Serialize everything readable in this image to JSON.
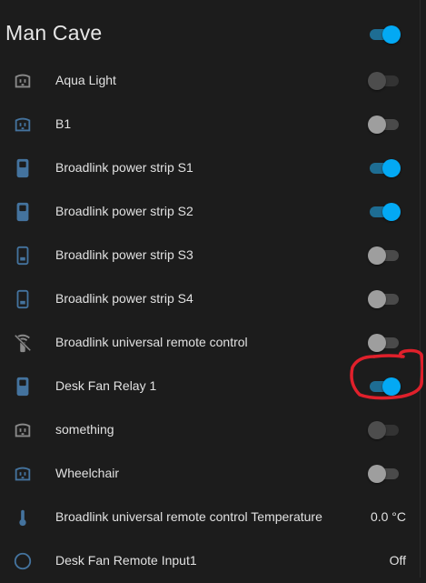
{
  "card": {
    "title": "Man Cave",
    "master_toggle": "on"
  },
  "colors": {
    "accent": "#03a9f4",
    "icon_blue": "#44739e",
    "icon_gray": "#8a8a8a",
    "annotation": "#e0202b"
  },
  "rows": [
    {
      "label": "Aqua Light",
      "icon": "outlet-icon",
      "state": "unavailable"
    },
    {
      "label": "B1",
      "icon": "outlet-icon",
      "state": "off"
    },
    {
      "label": "Broadlink power strip S1",
      "icon": "power-socket-icon",
      "state": "on"
    },
    {
      "label": "Broadlink power strip S2",
      "icon": "power-socket-icon",
      "state": "on"
    },
    {
      "label": "Broadlink power strip S3",
      "icon": "power-socket-outline-icon",
      "state": "off"
    },
    {
      "label": "Broadlink power strip S4",
      "icon": "power-socket-outline-icon",
      "state": "off"
    },
    {
      "label": "Broadlink universal remote control",
      "icon": "remote-off-icon",
      "state": "off"
    },
    {
      "label": "Desk Fan Relay 1",
      "icon": "power-socket-icon",
      "state": "on"
    },
    {
      "label": "something",
      "icon": "outlet-icon",
      "state": "unavailable"
    },
    {
      "label": "Wheelchair",
      "icon": "outlet-icon",
      "state": "off"
    },
    {
      "label": "Broadlink universal remote control Temperature",
      "icon": "thermometer-icon",
      "value": "0.0 °C"
    },
    {
      "label": "Desk Fan Remote Input1",
      "icon": "circle-outline-icon",
      "value": "Off"
    }
  ]
}
